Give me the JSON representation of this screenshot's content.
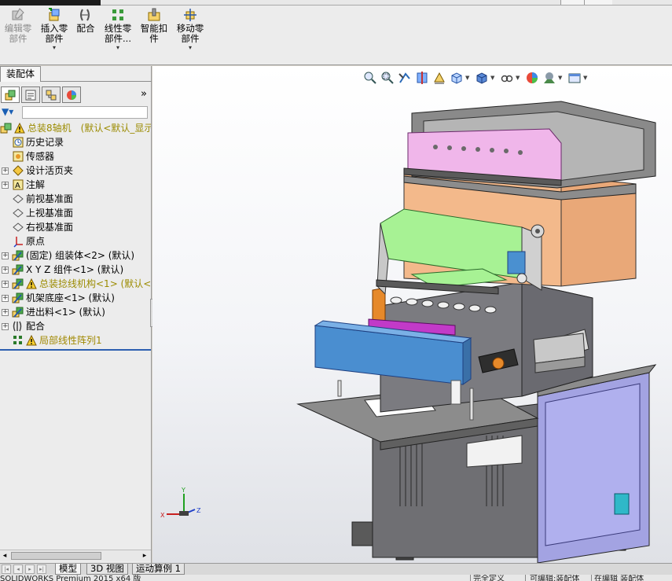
{
  "window": {
    "title": "SOLIDWORKS"
  },
  "toolbar": {
    "items": [
      {
        "label": "编辑零\n部件",
        "icon": "edit-component-icon",
        "disabled": true
      },
      {
        "label": "插入零\n部件",
        "icon": "insert-component-icon",
        "dropdown": true
      },
      {
        "label": "配合",
        "icon": "mate-icon"
      },
      {
        "label": "线性零\n部件...",
        "icon": "linear-pattern-icon",
        "dropdown": true
      },
      {
        "label": "智能扣\n件",
        "icon": "smart-fastener-icon"
      },
      {
        "label": "移动零\n部件",
        "icon": "move-component-icon",
        "dropdown": true
      }
    ]
  },
  "panel": {
    "tab": "装配体",
    "more": "»",
    "tree": [
      {
        "label": "总装8轴机　(默认<默认_显示",
        "icon": "assembly-icon",
        "warn": true,
        "color": "yellow",
        "expand": ""
      },
      {
        "label": "历史记录",
        "icon": "history-icon"
      },
      {
        "label": "传感器",
        "icon": "sensor-icon"
      },
      {
        "label": "设计活页夹",
        "icon": "design-binder-icon",
        "expand": "+"
      },
      {
        "label": "注解",
        "icon": "annotation-icon",
        "expand": "+"
      },
      {
        "label": "前视基准面",
        "icon": "plane-icon"
      },
      {
        "label": "上视基准面",
        "icon": "plane-icon"
      },
      {
        "label": "右视基准面",
        "icon": "plane-icon"
      },
      {
        "label": "原点",
        "icon": "origin-icon"
      },
      {
        "label": "(固定) 组装体<2> (默认)",
        "icon": "subassembly-icon",
        "expand": "+"
      },
      {
        "label": "X Y Z 组件<1> (默认)",
        "icon": "subassembly-icon",
        "expand": "+"
      },
      {
        "label": "总装捻线机构<1> (默认<",
        "icon": "subassembly-icon",
        "warn": true,
        "color": "yellow",
        "expand": "+"
      },
      {
        "label": "机架底座<1> (默认)",
        "icon": "subassembly-icon",
        "expand": "+"
      },
      {
        "label": "进出料<1> (默认)",
        "icon": "subassembly-icon",
        "expand": "+"
      },
      {
        "label": "配合",
        "icon": "mates-folder-icon",
        "expand": "+"
      },
      {
        "label": "局部线性阵列1",
        "icon": "local-pattern-icon",
        "warn": true,
        "color": "yellow2"
      }
    ]
  },
  "viewport": {
    "triad": {
      "x": "X",
      "y": "Y",
      "z": "Z"
    }
  },
  "bottom_tabs": [
    "模型",
    "3D 视图",
    "运动算例 1"
  ],
  "status": {
    "items": [
      "SOLIDWORKS Premium 2015 x64 版",
      "完全定义",
      "可编辑:装配体",
      "在编辑 装配体"
    ]
  },
  "colors": {
    "accent": "#2d5fb0",
    "warning_text": "#9b8b00",
    "machine_pink": "#f0b8ea",
    "machine_green": "#9ff08f",
    "machine_blue": "#4a90d0",
    "machine_lavender": "#9c9ce0",
    "machine_orange": "#f2b888"
  }
}
